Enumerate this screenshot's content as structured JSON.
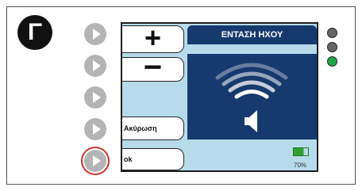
{
  "step_badge": "Γ",
  "softkeys": [
    "play-arrow",
    "play-arrow",
    "play-arrow",
    "play-arrow",
    "play-arrow"
  ],
  "highlighted_softkey_index": 4,
  "screen": {
    "plus_label": "+",
    "minus_label": "−",
    "cancel_label": "Ακύρωση",
    "ok_label": "ok",
    "title": "ΕΝΤΑΣΗ ΗΧΟΥ",
    "battery_text": "70%",
    "battery_level": 0.7
  },
  "leds": [
    {
      "state": "off",
      "color": "#666666"
    },
    {
      "state": "off",
      "color": "#666666"
    },
    {
      "state": "on",
      "color": "#1fa84a"
    }
  ],
  "colors": {
    "title_bar": "#163a6e",
    "screen_bg": "#b7dbeb",
    "highlight_ring": "#d0322a",
    "softkey": "#b4b4b4"
  }
}
